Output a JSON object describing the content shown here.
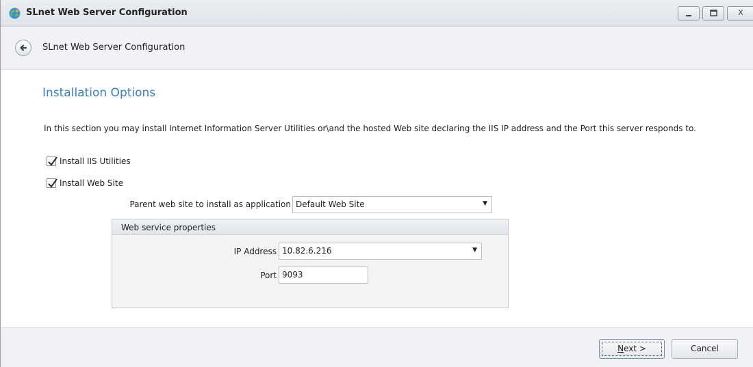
{
  "window": {
    "title": "SLnet Web Server Configuration",
    "controls": [
      "minimize-icon",
      "maximize-icon",
      "close-icon"
    ],
    "close_label": "X"
  },
  "nav": {
    "title": "SLnet Web Server Configuration",
    "back_icon": "back-arrow-icon"
  },
  "page": {
    "heading": "Installation Options",
    "description": "In this section you may install Internet Information Server Utilities or\\and the hosted Web site declaring the IIS IP address and the Port this server responds to."
  },
  "options": {
    "install_iis_utilities": {
      "label": "Install IIS Utilities",
      "checked": true
    },
    "install_web_site": {
      "label": "Install Web Site",
      "checked": true
    }
  },
  "parent_site": {
    "label": "Parent web site to install as application",
    "value": "Default Web Site"
  },
  "web_service": {
    "group_title": "Web service properties",
    "ip_label": "IP Address",
    "ip_value": "10.82.6.216",
    "port_label": "Port",
    "port_value": "9093"
  },
  "footer": {
    "next_mnemonic": "N",
    "next_rest": "ext >",
    "cancel_label": "Cancel"
  },
  "colors": {
    "heading": "#3a7fc1",
    "panel_bg": "#f1f2f5"
  }
}
